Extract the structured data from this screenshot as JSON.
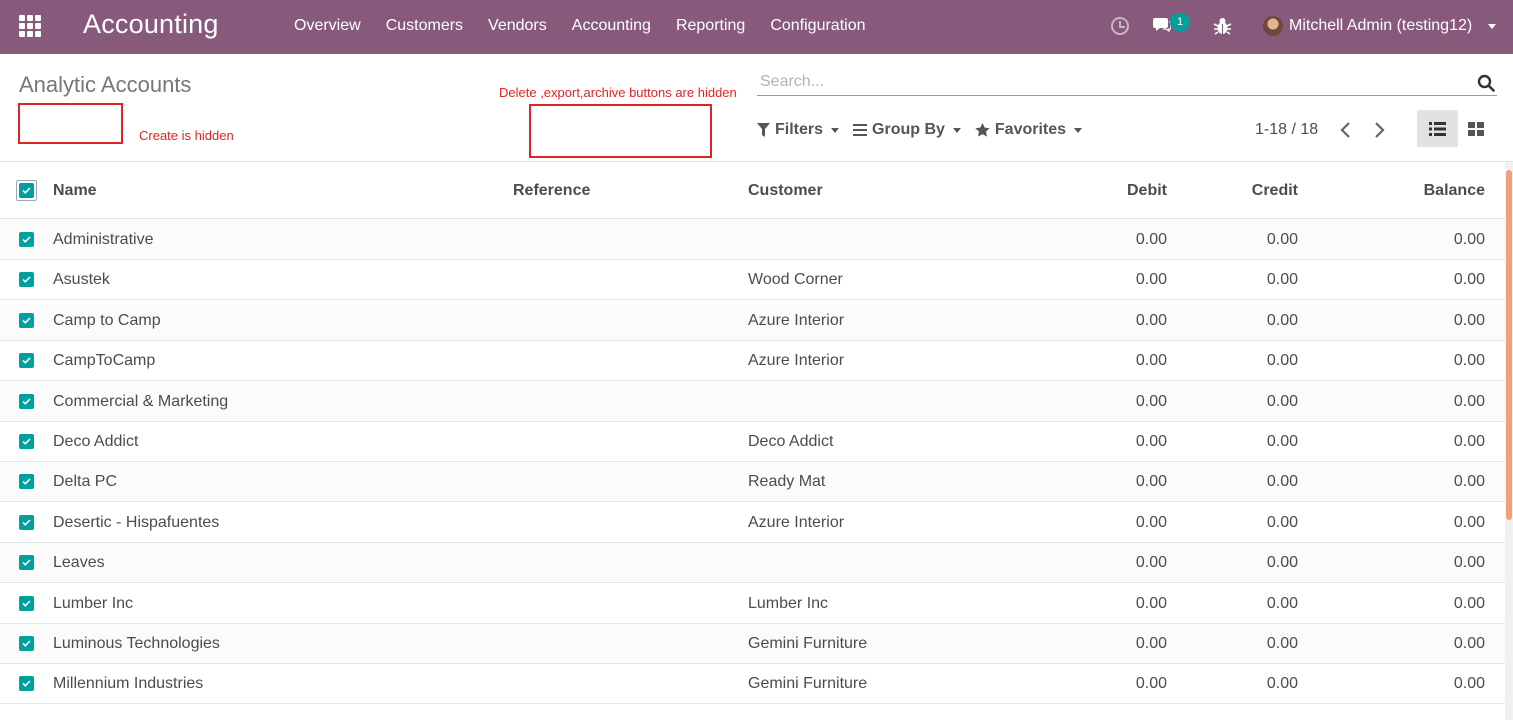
{
  "navbar": {
    "app_title": "Accounting",
    "menu": [
      "Overview",
      "Customers",
      "Vendors",
      "Accounting",
      "Reporting",
      "Configuration"
    ],
    "notification_count": "1",
    "user_name": "Mitchell Admin (testing12)",
    "bar_color": "#875a7b"
  },
  "control_panel": {
    "breadcrumb": "Analytic Accounts",
    "create_note": "Create is hidden",
    "hidden_note": "Delete ,export,archive buttons are hidden",
    "search_placeholder": "Search...",
    "filters_label": "Filters",
    "groupby_label": "Group By",
    "favorites_label": "Favorites",
    "pager": "1-18 / 18",
    "annotation_color": "#e02424"
  },
  "table": {
    "headers": {
      "name": "Name",
      "reference": "Reference",
      "customer": "Customer",
      "debit": "Debit",
      "credit": "Credit",
      "balance": "Balance"
    },
    "rows": [
      {
        "name": "Administrative",
        "reference": "",
        "customer": "",
        "debit": "0.00",
        "credit": "0.00",
        "balance": "0.00"
      },
      {
        "name": "Asustek",
        "reference": "",
        "customer": "Wood Corner",
        "debit": "0.00",
        "credit": "0.00",
        "balance": "0.00"
      },
      {
        "name": "Camp to Camp",
        "reference": "",
        "customer": "Azure Interior",
        "debit": "0.00",
        "credit": "0.00",
        "balance": "0.00"
      },
      {
        "name": "CampToCamp",
        "reference": "",
        "customer": "Azure Interior",
        "debit": "0.00",
        "credit": "0.00",
        "balance": "0.00"
      },
      {
        "name": "Commercial & Marketing",
        "reference": "",
        "customer": "",
        "debit": "0.00",
        "credit": "0.00",
        "balance": "0.00"
      },
      {
        "name": "Deco Addict",
        "reference": "",
        "customer": "Deco Addict",
        "debit": "0.00",
        "credit": "0.00",
        "balance": "0.00"
      },
      {
        "name": "Delta PC",
        "reference": "",
        "customer": "Ready Mat",
        "debit": "0.00",
        "credit": "0.00",
        "balance": "0.00"
      },
      {
        "name": "Desertic - Hispafuentes",
        "reference": "",
        "customer": "Azure Interior",
        "debit": "0.00",
        "credit": "0.00",
        "balance": "0.00"
      },
      {
        "name": "Leaves",
        "reference": "",
        "customer": "",
        "debit": "0.00",
        "credit": "0.00",
        "balance": "0.00"
      },
      {
        "name": "Lumber Inc",
        "reference": "",
        "customer": "Lumber Inc",
        "debit": "0.00",
        "credit": "0.00",
        "balance": "0.00"
      },
      {
        "name": "Luminous Technologies",
        "reference": "",
        "customer": "Gemini Furniture",
        "debit": "0.00",
        "credit": "0.00",
        "balance": "0.00"
      },
      {
        "name": "Millennium Industries",
        "reference": "",
        "customer": "Gemini Furniture",
        "debit": "0.00",
        "credit": "0.00",
        "balance": "0.00"
      }
    ]
  },
  "accent_color": "#00a09d"
}
